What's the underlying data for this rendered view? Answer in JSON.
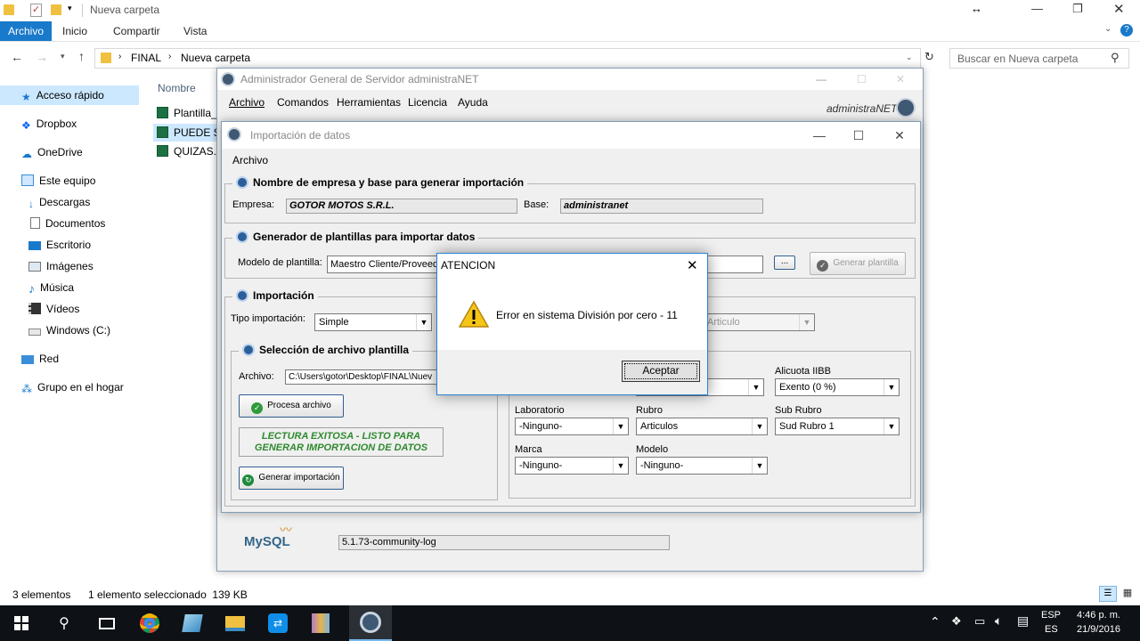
{
  "explorer": {
    "title": "Nueva carpeta",
    "tabs": [
      "Archivo",
      "Inicio",
      "Compartir",
      "Vista"
    ],
    "breadcrumb": [
      "FINAL",
      "Nueva carpeta"
    ],
    "search_placeholder": "Buscar en Nueva carpeta",
    "column_name": "Nombre",
    "files": [
      "Plantilla_",
      "PUEDE SI",
      "QUIZAS."
    ],
    "nav": {
      "quick_access": "Acceso rápido",
      "dropbox": "Dropbox",
      "onedrive": "OneDrive",
      "this_pc": "Este equipo",
      "downloads": "Descargas",
      "documents": "Documentos",
      "desktop": "Escritorio",
      "images": "Imágenes",
      "music": "Música",
      "videos": "Vídeos",
      "drive_c": "Windows (C:)",
      "network": "Red",
      "homegroup": "Grupo en el hogar"
    },
    "status_count": "3 elementos",
    "status_selected": "1 elemento seleccionado  139 KB"
  },
  "admin": {
    "title": "Administrador General de Servidor administraNET",
    "menu": [
      "Archivo",
      "Comandos",
      "Herramientas",
      "Licencia",
      "Ayuda"
    ],
    "brand": "administraNET",
    "mysql_logo": "MySQL",
    "mysql_version": "5.1.73-community-log"
  },
  "import": {
    "title": "Importación de datos",
    "menu_archivo": "Archivo",
    "g1_title": "Nombre de empresa y base para generar importación",
    "empresa_label": "Empresa:",
    "empresa_value": "GOTOR MOTOS S.R.L.",
    "base_label": "Base:",
    "base_value": "administranet",
    "g2_title": "Generador de plantillas para importar datos",
    "modelo_label": "Modelo de plantilla:",
    "modelo_value": "Maestro Cliente/Proveedo",
    "browse_label": "...",
    "generar_plantilla": "Generar plantilla",
    "g3_title": "Importación",
    "tipo_label": "Tipo importación:",
    "tipo_value": "Simple",
    "articulo_value": "Articulo",
    "g4_title": "Selección de archivo plantilla",
    "archivo_label": "Archivo:",
    "archivo_value": "C:\\Users\\gotor\\Desktop\\FINAL\\Nuev",
    "procesa_button": "Procesa archivo",
    "lectura_msg_1": "LECTURA EXITOSA - LISTO PARA",
    "lectura_msg_2": "GENERAR IMPORTACION DE DATOS",
    "generar_importacion": "Generar importación",
    "alicuota_label": "Alicuota IIBB",
    "alicuota_value": "Exento (0 %)",
    "laboratorio_label": "Laboratorio",
    "laboratorio_value": "-Ninguno-",
    "rubro_label": "Rubro",
    "rubro_value": "Articulos",
    "subrubro_label": "Sub Rubro",
    "subrubro_value": "Sud Rubro 1",
    "marca_label": "Marca",
    "marca_value": "-Ninguno-",
    "modelo2_label": "Modelo",
    "modelo2_value": "-Ninguno-"
  },
  "dialog": {
    "title": "ATENCION",
    "message": "Error en sistema División por cero - 11",
    "ok_label": "Aceptar"
  },
  "taskbar": {
    "lang_1": "ESP",
    "lang_2": "ES",
    "time": "4:46 p. m.",
    "date": "21/9/2016"
  }
}
